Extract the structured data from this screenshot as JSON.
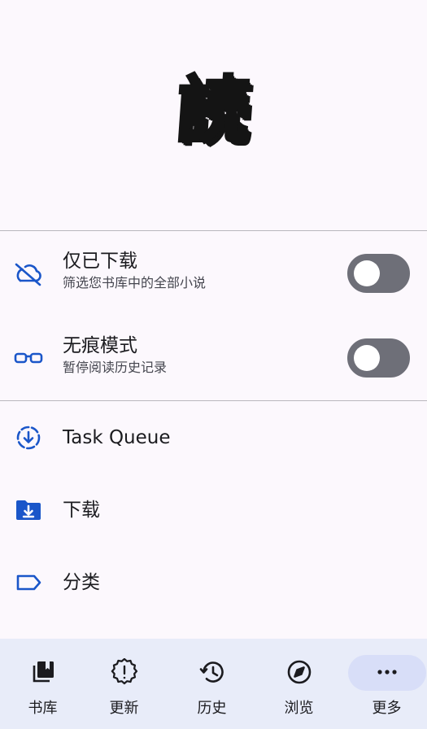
{
  "logo": {
    "glyph": "読"
  },
  "toggles": [
    {
      "title": "仅已下载",
      "subtitle": "筛选您书库中的全部小说",
      "icon": "cloud-off-icon",
      "on": false
    },
    {
      "title": "无痕模式",
      "subtitle": "暂停阅读历史记录",
      "icon": "glasses-icon",
      "on": false
    }
  ],
  "menu": [
    {
      "label": "Task Queue",
      "icon": "download-progress-icon"
    },
    {
      "label": "下载",
      "icon": "download-folder-icon"
    },
    {
      "label": "分类",
      "icon": "label-icon"
    }
  ],
  "nav": [
    {
      "label": "书库",
      "icon": "library-icon"
    },
    {
      "label": "更新",
      "icon": "updates-badge-icon"
    },
    {
      "label": "历史",
      "icon": "history-icon"
    },
    {
      "label": "浏览",
      "icon": "compass-icon"
    },
    {
      "label": "更多",
      "icon": "more-dots-icon",
      "selected": true
    }
  ],
  "colors": {
    "accent": "#1a56c9",
    "toggle_off": "#6e6f78",
    "nav_bg": "#e8ecf9",
    "nav_selected": "#d8def8"
  }
}
